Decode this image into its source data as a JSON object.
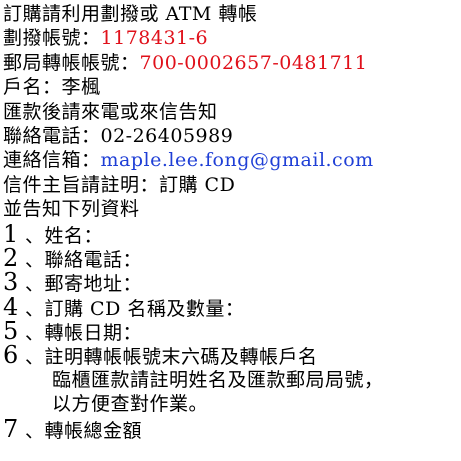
{
  "colors": {
    "text": "#000000",
    "account_red": "#e0101a",
    "email_blue": "#1f3fd6"
  },
  "document": {
    "intro": "訂購請利用劃撥或 ATM 轉帳",
    "postal_label": "劃撥帳號：",
    "postal_value": "1178431-6",
    "transfer_label": "郵局轉帳帳號：",
    "transfer_value": "700-0002657-0481711",
    "holder": "戶名：李楓",
    "remit_note": "匯款後請來電或來信告知",
    "phone": "聯絡電話：02-26405989",
    "email_label": "連絡信箱：",
    "email_value": "maple.lee.fong@gmail.com",
    "subject": "信件主旨請註明：訂購 CD",
    "list_intro": "並告知下列資料",
    "items": [
      {
        "num": "1",
        "text": "、姓名："
      },
      {
        "num": "2",
        "text": "、聯絡電話："
      },
      {
        "num": "3",
        "text": "、郵寄地址："
      },
      {
        "num": "4",
        "text": "、訂購 CD 名稱及數量："
      },
      {
        "num": "5",
        "text": "、轉帳日期："
      },
      {
        "num": "6",
        "text": "、註明轉帳帳號末六碼及轉帳戶名"
      }
    ],
    "item6_cont1": "臨櫃匯款請註明姓名及匯款郵局局號，",
    "item6_cont2": "以方便查對作業。",
    "item7": {
      "num": "7",
      "text": "、轉帳總金額"
    }
  }
}
